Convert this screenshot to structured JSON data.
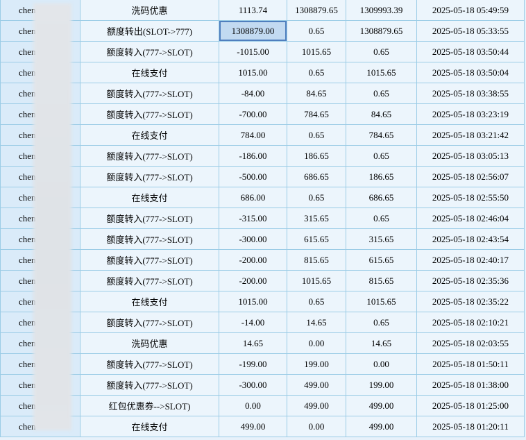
{
  "colors": {
    "page_bg": "#e7f1fa",
    "grid_border": "#9bcce6",
    "cell_bg": "#ecf5fc",
    "username_col_bg": "#daebf9",
    "selected_cell_bg": "#c2daf1",
    "selected_cell_border": "#4f7fbe",
    "redaction_bg": "#e0e4e8"
  },
  "table": {
    "username_visible_prefix": "chen",
    "selected_cell": {
      "row_index": 1,
      "column": "amount"
    },
    "rows": [
      {
        "username": "chen",
        "type": "洗码优惠",
        "amount": "1113.74",
        "balance_before": "1308879.65",
        "balance_after": "1309993.39",
        "time": "2025-05-18 05:49:59"
      },
      {
        "username": "chen",
        "type": "额度转出(SLOT->777)",
        "amount": "1308879.00",
        "balance_before": "0.65",
        "balance_after": "1308879.65",
        "time": "2025-05-18 05:33:55"
      },
      {
        "username": "chen",
        "type": "额度转入(777->SLOT)",
        "amount": "-1015.00",
        "balance_before": "1015.65",
        "balance_after": "0.65",
        "time": "2025-05-18 03:50:44"
      },
      {
        "username": "chen",
        "type": "在线支付",
        "amount": "1015.00",
        "balance_before": "0.65",
        "balance_after": "1015.65",
        "time": "2025-05-18 03:50:04"
      },
      {
        "username": "chen",
        "type": "额度转入(777->SLOT)",
        "amount": "-84.00",
        "balance_before": "84.65",
        "balance_after": "0.65",
        "time": "2025-05-18 03:38:55"
      },
      {
        "username": "chen",
        "type": "额度转入(777->SLOT)",
        "amount": "-700.00",
        "balance_before": "784.65",
        "balance_after": "84.65",
        "time": "2025-05-18 03:23:19"
      },
      {
        "username": "chen",
        "type": "在线支付",
        "amount": "784.00",
        "balance_before": "0.65",
        "balance_after": "784.65",
        "time": "2025-05-18 03:21:42"
      },
      {
        "username": "chen",
        "type": "额度转入(777->SLOT)",
        "amount": "-186.00",
        "balance_before": "186.65",
        "balance_after": "0.65",
        "time": "2025-05-18 03:05:13"
      },
      {
        "username": "chen",
        "type": "额度转入(777->SLOT)",
        "amount": "-500.00",
        "balance_before": "686.65",
        "balance_after": "186.65",
        "time": "2025-05-18 02:56:07"
      },
      {
        "username": "chen",
        "type": "在线支付",
        "amount": "686.00",
        "balance_before": "0.65",
        "balance_after": "686.65",
        "time": "2025-05-18 02:55:50"
      },
      {
        "username": "chen",
        "type": "额度转入(777->SLOT)",
        "amount": "-315.00",
        "balance_before": "315.65",
        "balance_after": "0.65",
        "time": "2025-05-18 02:46:04"
      },
      {
        "username": "chen",
        "type": "额度转入(777->SLOT)",
        "amount": "-300.00",
        "balance_before": "615.65",
        "balance_after": "315.65",
        "time": "2025-05-18 02:43:54"
      },
      {
        "username": "chen",
        "type": "额度转入(777->SLOT)",
        "amount": "-200.00",
        "balance_before": "815.65",
        "balance_after": "615.65",
        "time": "2025-05-18 02:40:17"
      },
      {
        "username": "chen",
        "type": "额度转入(777->SLOT)",
        "amount": "-200.00",
        "balance_before": "1015.65",
        "balance_after": "815.65",
        "time": "2025-05-18 02:35:36"
      },
      {
        "username": "chen",
        "type": "在线支付",
        "amount": "1015.00",
        "balance_before": "0.65",
        "balance_after": "1015.65",
        "time": "2025-05-18 02:35:22"
      },
      {
        "username": "chen",
        "type": "额度转入(777->SLOT)",
        "amount": "-14.00",
        "balance_before": "14.65",
        "balance_after": "0.65",
        "time": "2025-05-18 02:10:21"
      },
      {
        "username": "chen",
        "type": "洗码优惠",
        "amount": "14.65",
        "balance_before": "0.00",
        "balance_after": "14.65",
        "time": "2025-05-18 02:03:55"
      },
      {
        "username": "chen",
        "type": "额度转入(777->SLOT)",
        "amount": "-199.00",
        "balance_before": "199.00",
        "balance_after": "0.00",
        "time": "2025-05-18 01:50:11"
      },
      {
        "username": "chen",
        "type": "额度转入(777->SLOT)",
        "amount": "-300.00",
        "balance_before": "499.00",
        "balance_after": "199.00",
        "time": "2025-05-18 01:38:00"
      },
      {
        "username": "chen",
        "type": "红包优惠券-->SLOT)",
        "amount": "0.00",
        "balance_before": "499.00",
        "balance_after": "499.00",
        "time": "2025-05-18 01:25:00"
      },
      {
        "username": "chen",
        "type": "在线支付",
        "amount": "499.00",
        "balance_before": "0.00",
        "balance_after": "499.00",
        "time": "2025-05-18 01:20:11"
      }
    ]
  }
}
